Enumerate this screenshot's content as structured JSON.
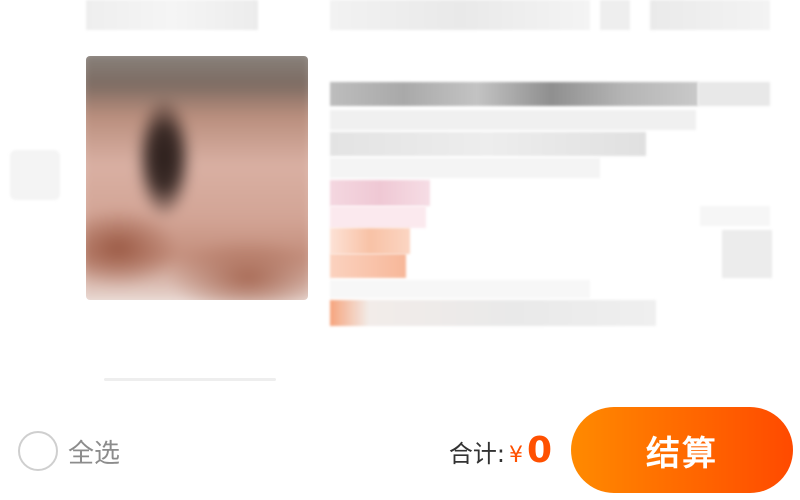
{
  "cart_item": {
    "thumbnail_icon": "product-image",
    "details_obscured": true
  },
  "bottom_bar": {
    "select_all_label": "全选",
    "select_all_checked": false,
    "total_label": "合计:",
    "currency_symbol": "¥",
    "total_amount": "0",
    "checkout_label": "结算",
    "accent_color": "#ff5000",
    "button_gradient": [
      "#ff8a00",
      "#ff4a00"
    ]
  }
}
